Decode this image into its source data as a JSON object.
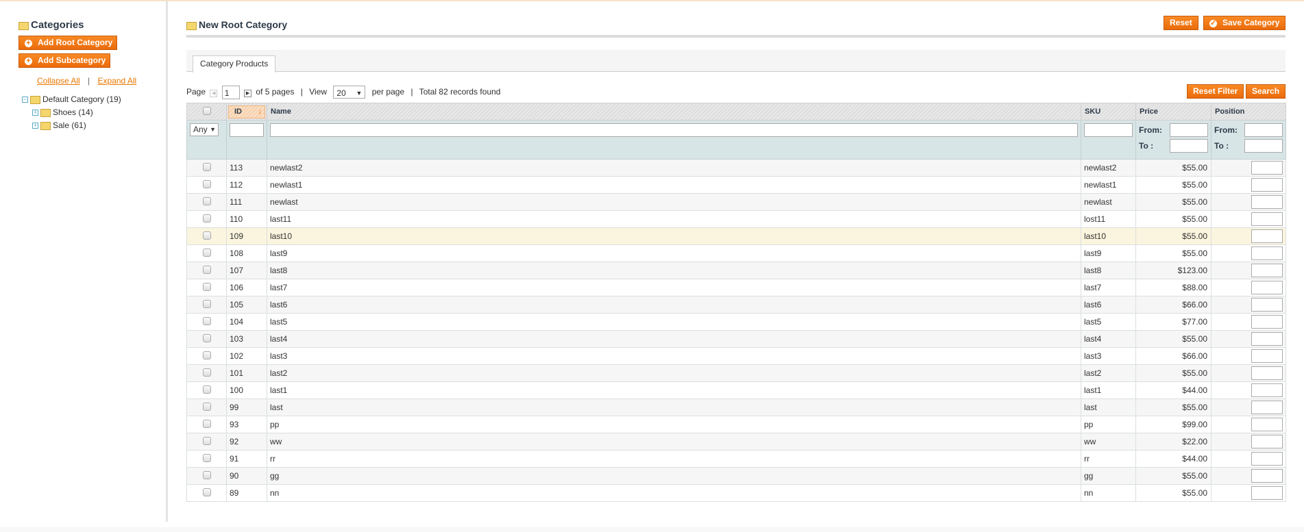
{
  "sidebar": {
    "title": "Categories",
    "add_root": "Add Root Category",
    "add_sub": "Add Subcategory",
    "collapse": "Collapse All",
    "separator": "|",
    "expand": "Expand All",
    "tree": [
      {
        "label": "Default Category (19)",
        "level": 0,
        "toggle": "−"
      },
      {
        "label": "Shoes (14)",
        "level": 1,
        "toggle": "+"
      },
      {
        "label": "Sale (61)",
        "level": 1,
        "toggle": "+"
      }
    ]
  },
  "header": {
    "title": "New Root Category",
    "reset": "Reset",
    "save": "Save Category"
  },
  "tabs": [
    {
      "label": "Category Products",
      "active": true
    }
  ],
  "pager": {
    "page_label": "Page",
    "page": "1",
    "of_pages": "of 5 pages",
    "sep": "|",
    "view_label": "View",
    "per_page": "20",
    "per_page_label": "per page",
    "total": "Total 82 records found"
  },
  "grid": {
    "reset_filter": "Reset Filter",
    "search": "Search",
    "columns": {
      "id": "ID",
      "name": "Name",
      "sku": "SKU",
      "price": "Price",
      "position": "Position"
    },
    "filter": {
      "any": "Any",
      "from": "From:",
      "to": "To :"
    },
    "rows": [
      [
        "113",
        "newlast2",
        "newlast2",
        "$55.00"
      ],
      [
        "112",
        "newlast1",
        "newlast1",
        "$55.00"
      ],
      [
        "111",
        "newlast",
        "newlast",
        "$55.00"
      ],
      [
        "110",
        "last11",
        "lost11",
        "$55.00"
      ],
      [
        "109",
        "last10",
        "last10",
        "$55.00"
      ],
      [
        "108",
        "last9",
        "last9",
        "$55.00"
      ],
      [
        "107",
        "last8",
        "last8",
        "$123.00"
      ],
      [
        "106",
        "last7",
        "last7",
        "$88.00"
      ],
      [
        "105",
        "last6",
        "last6",
        "$66.00"
      ],
      [
        "104",
        "last5",
        "last5",
        "$77.00"
      ],
      [
        "103",
        "last4",
        "last4",
        "$55.00"
      ],
      [
        "102",
        "last3",
        "last3",
        "$66.00"
      ],
      [
        "101",
        "last2",
        "last2",
        "$55.00"
      ],
      [
        "100",
        "last1",
        "last1",
        "$44.00"
      ],
      [
        "99",
        "last",
        "last",
        "$55.00"
      ],
      [
        "93",
        "pp",
        "pp",
        "$99.00"
      ],
      [
        "92",
        "ww",
        "ww",
        "$22.00"
      ],
      [
        "91",
        "rr",
        "rr",
        "$44.00"
      ],
      [
        "90",
        "gg",
        "gg",
        "$55.00"
      ],
      [
        "89",
        "nn",
        "nn",
        "$55.00"
      ]
    ]
  },
  "colors": {
    "accent": "#ef7410",
    "highlight_row": "#fbf4de",
    "filter_bg": "#d8e5e7"
  }
}
